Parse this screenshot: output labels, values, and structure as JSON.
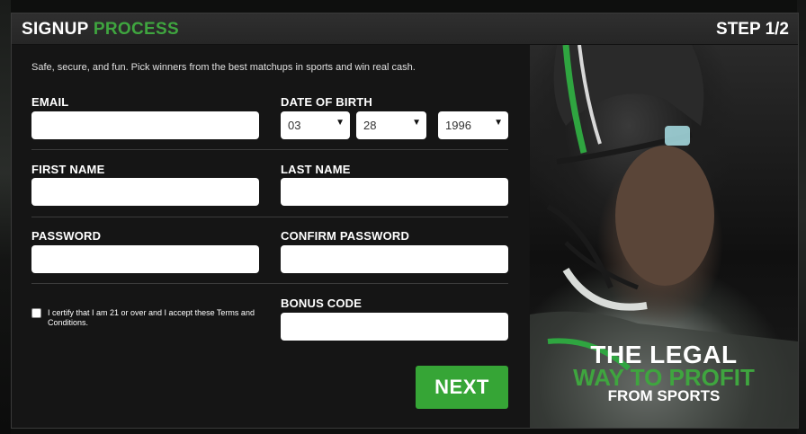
{
  "header": {
    "title_part1": "SIGNUP",
    "title_part2": "PROCESS",
    "step": "STEP 1/2"
  },
  "form": {
    "intro": "Safe, secure, and fun. Pick winners from the best matchups in sports and win real cash.",
    "email": {
      "label": "EMAIL",
      "value": ""
    },
    "dob": {
      "label": "DATE OF BIRTH",
      "month": "03",
      "day": "28",
      "year": "1996"
    },
    "first_name": {
      "label": "FIRST NAME",
      "value": ""
    },
    "last_name": {
      "label": "LAST NAME",
      "value": ""
    },
    "password": {
      "label": "PASSWORD",
      "value": ""
    },
    "confirm_password": {
      "label": "CONFIRM PASSWORD",
      "value": ""
    },
    "certify": {
      "text": "I certify that I am 21 or over and I accept these Terms and Conditions.",
      "checked": false
    },
    "bonus_code": {
      "label": "BONUS CODE",
      "value": ""
    },
    "next_label": "NEXT"
  },
  "hero": {
    "line1": "THE LEGAL",
    "line2": "WAY TO PROFIT",
    "line3": "FROM SPORTS"
  },
  "colors": {
    "accent": "#3fa53f",
    "button": "#36a536",
    "panel": "#151515"
  }
}
